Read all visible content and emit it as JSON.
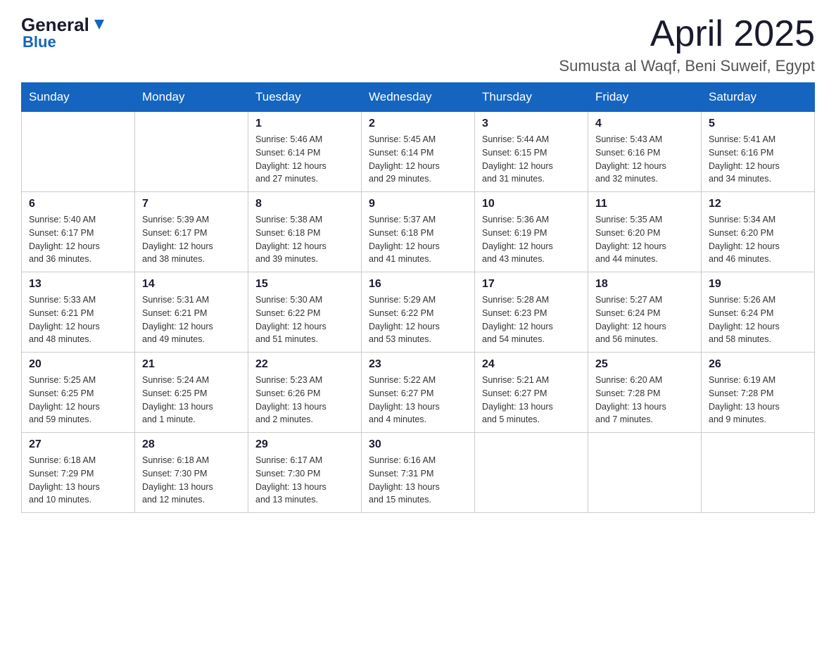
{
  "header": {
    "logo_general": "General",
    "logo_blue": "Blue",
    "title": "April 2025",
    "subtitle": "Sumusta al Waqf, Beni Suweif, Egypt"
  },
  "calendar": {
    "days_of_week": [
      "Sunday",
      "Monday",
      "Tuesday",
      "Wednesday",
      "Thursday",
      "Friday",
      "Saturday"
    ],
    "weeks": [
      [
        {
          "day": "",
          "info": ""
        },
        {
          "day": "",
          "info": ""
        },
        {
          "day": "1",
          "info": "Sunrise: 5:46 AM\nSunset: 6:14 PM\nDaylight: 12 hours\nand 27 minutes."
        },
        {
          "day": "2",
          "info": "Sunrise: 5:45 AM\nSunset: 6:14 PM\nDaylight: 12 hours\nand 29 minutes."
        },
        {
          "day": "3",
          "info": "Sunrise: 5:44 AM\nSunset: 6:15 PM\nDaylight: 12 hours\nand 31 minutes."
        },
        {
          "day": "4",
          "info": "Sunrise: 5:43 AM\nSunset: 6:16 PM\nDaylight: 12 hours\nand 32 minutes."
        },
        {
          "day": "5",
          "info": "Sunrise: 5:41 AM\nSunset: 6:16 PM\nDaylight: 12 hours\nand 34 minutes."
        }
      ],
      [
        {
          "day": "6",
          "info": "Sunrise: 5:40 AM\nSunset: 6:17 PM\nDaylight: 12 hours\nand 36 minutes."
        },
        {
          "day": "7",
          "info": "Sunrise: 5:39 AM\nSunset: 6:17 PM\nDaylight: 12 hours\nand 38 minutes."
        },
        {
          "day": "8",
          "info": "Sunrise: 5:38 AM\nSunset: 6:18 PM\nDaylight: 12 hours\nand 39 minutes."
        },
        {
          "day": "9",
          "info": "Sunrise: 5:37 AM\nSunset: 6:18 PM\nDaylight: 12 hours\nand 41 minutes."
        },
        {
          "day": "10",
          "info": "Sunrise: 5:36 AM\nSunset: 6:19 PM\nDaylight: 12 hours\nand 43 minutes."
        },
        {
          "day": "11",
          "info": "Sunrise: 5:35 AM\nSunset: 6:20 PM\nDaylight: 12 hours\nand 44 minutes."
        },
        {
          "day": "12",
          "info": "Sunrise: 5:34 AM\nSunset: 6:20 PM\nDaylight: 12 hours\nand 46 minutes."
        }
      ],
      [
        {
          "day": "13",
          "info": "Sunrise: 5:33 AM\nSunset: 6:21 PM\nDaylight: 12 hours\nand 48 minutes."
        },
        {
          "day": "14",
          "info": "Sunrise: 5:31 AM\nSunset: 6:21 PM\nDaylight: 12 hours\nand 49 minutes."
        },
        {
          "day": "15",
          "info": "Sunrise: 5:30 AM\nSunset: 6:22 PM\nDaylight: 12 hours\nand 51 minutes."
        },
        {
          "day": "16",
          "info": "Sunrise: 5:29 AM\nSunset: 6:22 PM\nDaylight: 12 hours\nand 53 minutes."
        },
        {
          "day": "17",
          "info": "Sunrise: 5:28 AM\nSunset: 6:23 PM\nDaylight: 12 hours\nand 54 minutes."
        },
        {
          "day": "18",
          "info": "Sunrise: 5:27 AM\nSunset: 6:24 PM\nDaylight: 12 hours\nand 56 minutes."
        },
        {
          "day": "19",
          "info": "Sunrise: 5:26 AM\nSunset: 6:24 PM\nDaylight: 12 hours\nand 58 minutes."
        }
      ],
      [
        {
          "day": "20",
          "info": "Sunrise: 5:25 AM\nSunset: 6:25 PM\nDaylight: 12 hours\nand 59 minutes."
        },
        {
          "day": "21",
          "info": "Sunrise: 5:24 AM\nSunset: 6:25 PM\nDaylight: 13 hours\nand 1 minute."
        },
        {
          "day": "22",
          "info": "Sunrise: 5:23 AM\nSunset: 6:26 PM\nDaylight: 13 hours\nand 2 minutes."
        },
        {
          "day": "23",
          "info": "Sunrise: 5:22 AM\nSunset: 6:27 PM\nDaylight: 13 hours\nand 4 minutes."
        },
        {
          "day": "24",
          "info": "Sunrise: 5:21 AM\nSunset: 6:27 PM\nDaylight: 13 hours\nand 5 minutes."
        },
        {
          "day": "25",
          "info": "Sunrise: 6:20 AM\nSunset: 7:28 PM\nDaylight: 13 hours\nand 7 minutes."
        },
        {
          "day": "26",
          "info": "Sunrise: 6:19 AM\nSunset: 7:28 PM\nDaylight: 13 hours\nand 9 minutes."
        }
      ],
      [
        {
          "day": "27",
          "info": "Sunrise: 6:18 AM\nSunset: 7:29 PM\nDaylight: 13 hours\nand 10 minutes."
        },
        {
          "day": "28",
          "info": "Sunrise: 6:18 AM\nSunset: 7:30 PM\nDaylight: 13 hours\nand 12 minutes."
        },
        {
          "day": "29",
          "info": "Sunrise: 6:17 AM\nSunset: 7:30 PM\nDaylight: 13 hours\nand 13 minutes."
        },
        {
          "day": "30",
          "info": "Sunrise: 6:16 AM\nSunset: 7:31 PM\nDaylight: 13 hours\nand 15 minutes."
        },
        {
          "day": "",
          "info": ""
        },
        {
          "day": "",
          "info": ""
        },
        {
          "day": "",
          "info": ""
        }
      ]
    ]
  }
}
